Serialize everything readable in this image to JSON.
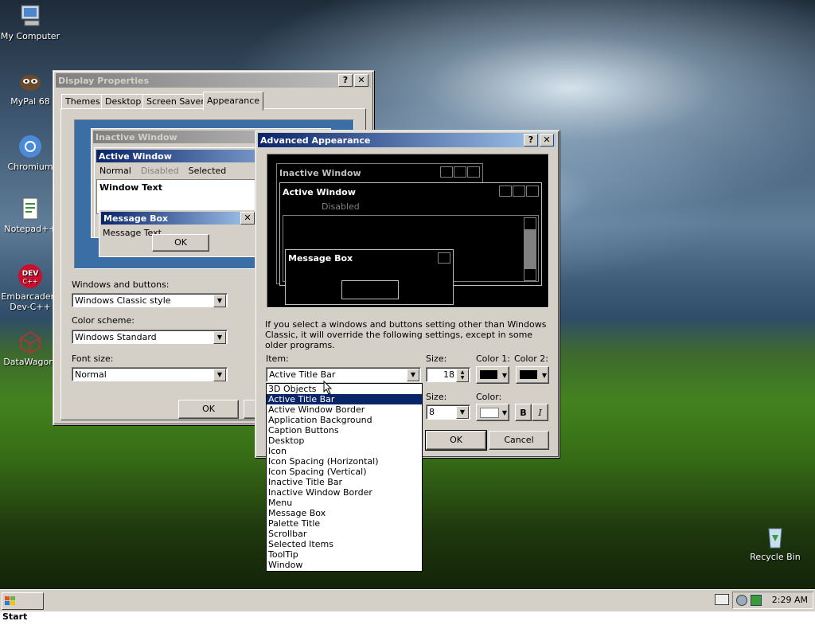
{
  "desktop": {
    "icons": [
      {
        "label": "My Computer",
        "icon": "computer-icon"
      },
      {
        "label": "MyPal 68",
        "icon": "mypal-icon"
      },
      {
        "label": "Chromium",
        "icon": "chromium-icon"
      },
      {
        "label": "Notepad++",
        "icon": "notepadpp-icon"
      },
      {
        "label": "Embarcadero Dev-C++",
        "icon": "devcpp-icon"
      },
      {
        "label": "DataWagon.",
        "icon": "datawagon-icon"
      },
      {
        "label": "Recycle Bin",
        "icon": "recycle-bin-icon"
      }
    ]
  },
  "display_properties": {
    "title": "Display Properties",
    "help": "?",
    "close": "✕",
    "tabs": [
      "Themes",
      "Desktop",
      "Screen Saver",
      "Appearance"
    ],
    "preview": {
      "inactive_title": "Inactive Window",
      "active_title": "Active Window",
      "menu": [
        "Normal",
        "Disabled",
        "Selected"
      ],
      "window_text": "Window Text",
      "msgbox_title": "Message Box",
      "msgbox_close": "✕",
      "msgbox_text": "Message Text",
      "ok": "OK"
    },
    "windows_buttons_label": "Windows and buttons:",
    "windows_buttons_value": "Windows Classic style",
    "color_scheme_label": "Color scheme:",
    "color_scheme_value": "Windows Standard",
    "font_size_label": "Font size:",
    "font_size_value": "Normal",
    "ok": "OK"
  },
  "advanced": {
    "title": "Advanced Appearance",
    "help": "?",
    "close": "✕",
    "preview": {
      "inactive_title": "Inactive Window",
      "active_title": "Active Window",
      "disabled": "Disabled",
      "msgbox_title": "Message Box"
    },
    "info": "If you select a windows and buttons setting other than Windows Classic, it will override the following settings, except in some older programs.",
    "item_label": "Item:",
    "item_value": "Active Title Bar",
    "size_label": "Size:",
    "size_value": "18",
    "color1_label": "Color 1:",
    "color2_label": "Color 2:",
    "font_size_label": "Size:",
    "font_size_value": "8",
    "color_label": "Color:",
    "bold": "B",
    "italic": "I",
    "ok": "OK",
    "cancel": "Cancel",
    "item_options": [
      "3D Objects",
      "Active Title Bar",
      "Active Window Border",
      "Application Background",
      "Caption Buttons",
      "Desktop",
      "Icon",
      "Icon Spacing (Horizontal)",
      "Icon Spacing (Vertical)",
      "Inactive Title Bar",
      "Inactive Window Border",
      "Menu",
      "Message Box",
      "Palette Title",
      "Scrollbar",
      "Selected Items",
      "ToolTip",
      "Window"
    ],
    "selected_index": 1
  },
  "taskbar": {
    "start": "Start",
    "clock": "2:29 AM"
  },
  "colors": {
    "active_title": "#0a246a",
    "inactive_title": "#808080",
    "face": "#d4d0c8"
  }
}
